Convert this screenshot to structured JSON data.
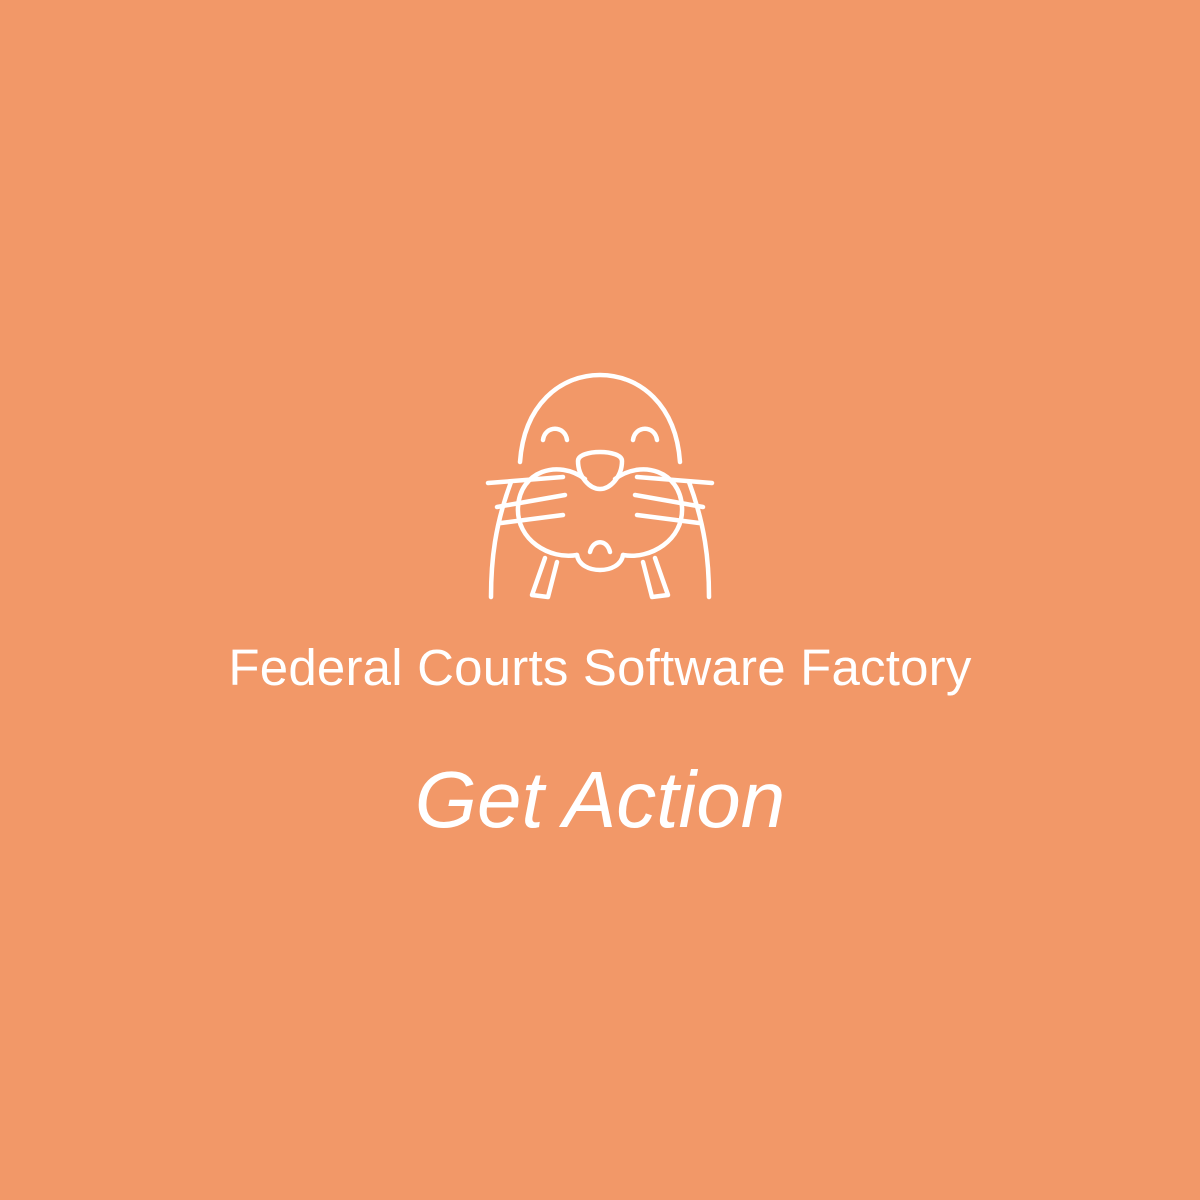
{
  "org_name": "Federal Courts Software Factory",
  "app_title": "Get Action",
  "logo": {
    "icon": "walrus-icon"
  },
  "colors": {
    "background": "#f29868",
    "foreground": "#ffffff"
  }
}
